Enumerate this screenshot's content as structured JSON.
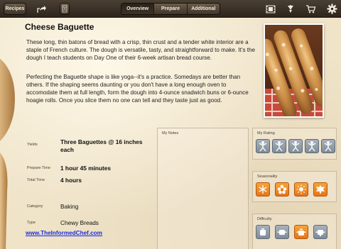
{
  "toolbar": {
    "recipes_label": "Recipes",
    "share_icon": "share-icon",
    "bookmark_icon": "bookmark-icon",
    "tabs": [
      {
        "label": "Overview",
        "active": true
      },
      {
        "label": "Prepare",
        "active": false
      },
      {
        "label": "Additional",
        "active": false
      }
    ],
    "right_icons": [
      "film-icon",
      "food-icon",
      "cart-icon",
      "gear-icon"
    ]
  },
  "recipe": {
    "title": "Cheese Baguette",
    "paragraph1": "These long, thin batons of bread with a crisp, thin crust and a tender white interior are a staple of French culture. The dough is versatile, tasty, and straightforward to make. It's the dough I teach students on Day One of their 6-week artisan bread course.",
    "paragraph2": "Perfecting the Baguette shape is like yoga--it's a practice. Somedays are better than others. If the shaping seems daunting or you don't have a long enough oven to accomodate them at full length, form the dough into 4-ounce snadwich buns or 6-ounce hoagie rolls. Once you slice them no one can tell and they taste just as good.",
    "details": {
      "yields_label": "Yields",
      "yields_value": "Three Baguettes @ 16 inches each",
      "prepare_time_label": "Prepare Time",
      "prepare_time_value": "1 hour 45 minutes",
      "total_time_label": "Total Time",
      "total_time_value": "4 hours",
      "category_label": "Category",
      "category_value": "Baking",
      "type_label": "Type",
      "type_value": "Chewy Breads"
    },
    "website": "www.TheInformedChef.com"
  },
  "notes": {
    "title": "My Notes"
  },
  "rating": {
    "title": "My Rating",
    "icons": [
      "chef-figure-icon",
      "chef-figure-icon",
      "chef-figure-icon",
      "chef-figure-icon",
      "chef-figure-icon"
    ],
    "value": 0,
    "max": 5
  },
  "seasonality": {
    "title": "Seasonality",
    "icons": [
      "snowflake-icon",
      "flower-icon",
      "sun-icon",
      "leaf-icon"
    ],
    "color": "#f08a24"
  },
  "difficulty": {
    "title": "Difficulty",
    "icons": [
      "pot-icon",
      "pan-icon",
      "pot-icon",
      "pan-icon"
    ],
    "selected": 3
  },
  "colors": {
    "toolbar": "#3a3026",
    "paper": "#efe3c8",
    "link": "#1a2bd8",
    "accent": "#f08a24",
    "inactive": "#8e9aa6"
  }
}
